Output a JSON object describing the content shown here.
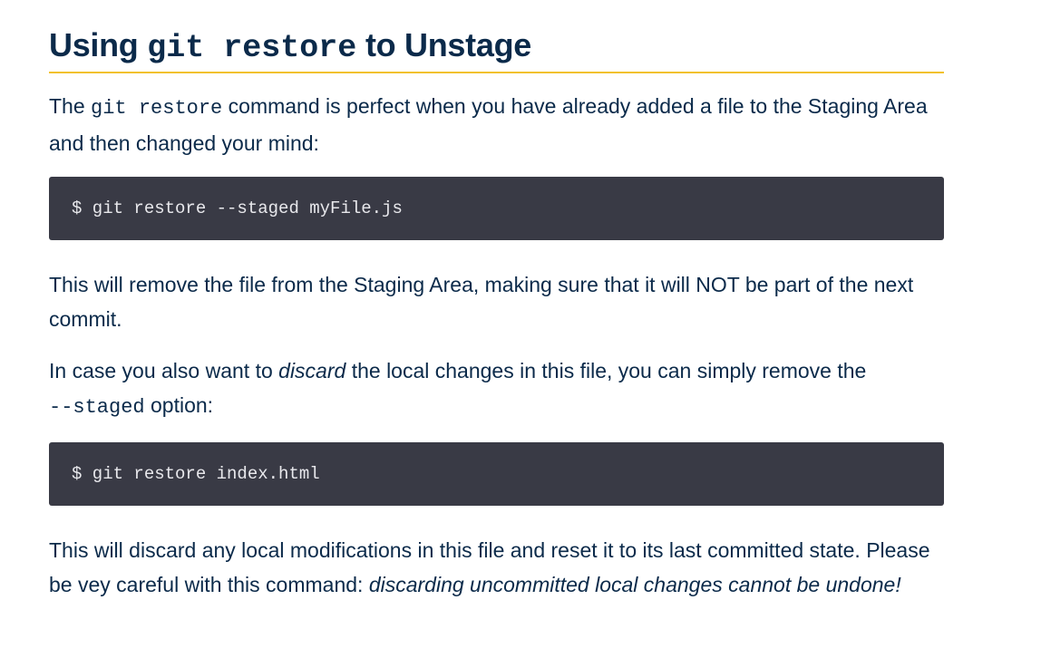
{
  "heading": {
    "prefix": "Using ",
    "code": "git restore",
    "suffix": " to Unstage"
  },
  "para1": {
    "before": "The ",
    "code": "git restore",
    "after": " command is perfect when you have already added a file to the Staging Area and then changed your mind:"
  },
  "code1": "$ git restore --staged myFile.js",
  "para2": "This will remove the file from the Staging Area, making sure that it will NOT be part of the next commit.",
  "para3": {
    "before": "In case you also want to ",
    "emphasis": "discard",
    "middle": " the local changes in this file, you can simply remove the ",
    "code": "--staged",
    "after": " option:"
  },
  "code2": "$ git restore index.html",
  "para4": {
    "before": "This will discard any local modifications in this file and reset it to its last committed state. Please be vey careful with this command: ",
    "emphasis": "discarding uncommitted local changes cannot be undone!"
  },
  "colors": {
    "text": "#0b2a4a",
    "underline_accent": "#f2c12e",
    "code_block_background": "#393a45",
    "code_block_text": "#e8e8ec"
  }
}
